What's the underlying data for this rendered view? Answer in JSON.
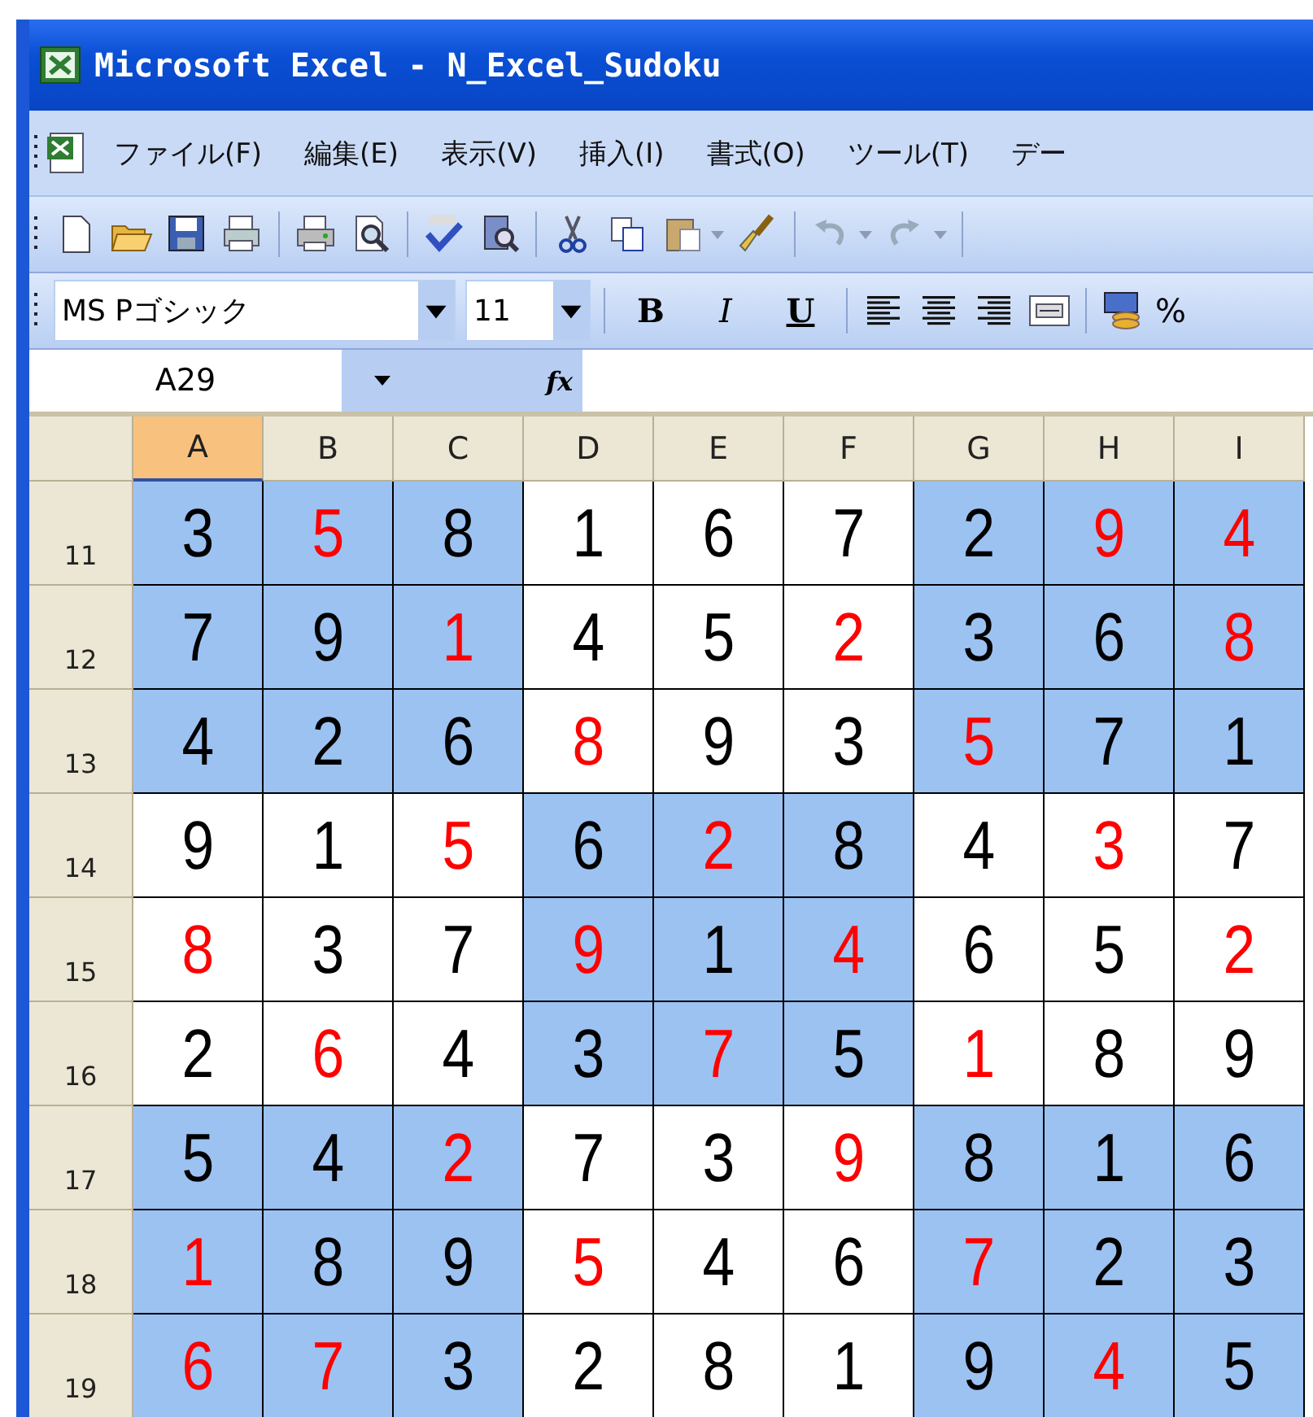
{
  "window": {
    "title": "Microsoft Excel - N_Excel_Sudoku"
  },
  "menu": [
    "ファイル(F)",
    "編集(E)",
    "表示(V)",
    "挿入(I)",
    "書式(O)",
    "ツール(T)",
    "デー"
  ],
  "formatting_toolbar": {
    "font": "MS Pゴシック",
    "size": "11",
    "bold": "B",
    "italic": "I",
    "underline": "U",
    "percent": "%"
  },
  "formula_bar": {
    "name_box": "A29",
    "fx": "fx"
  },
  "sheet": {
    "columns": [
      {
        "label": "A",
        "selected": true
      },
      {
        "label": "B",
        "selected": false
      },
      {
        "label": "C",
        "selected": false
      },
      {
        "label": "D",
        "selected": false
      },
      {
        "label": "E",
        "selected": false
      },
      {
        "label": "F",
        "selected": false
      },
      {
        "label": "G",
        "selected": false
      },
      {
        "label": "H",
        "selected": false
      },
      {
        "label": "I",
        "selected": false
      }
    ],
    "rows": [
      {
        "label": "11",
        "cells": [
          {
            "value": "3",
            "red": false,
            "shaded": true
          },
          {
            "value": "5",
            "red": true,
            "shaded": true
          },
          {
            "value": "8",
            "red": false,
            "shaded": true
          },
          {
            "value": "1",
            "red": false,
            "shaded": false
          },
          {
            "value": "6",
            "red": false,
            "shaded": false
          },
          {
            "value": "7",
            "red": false,
            "shaded": false
          },
          {
            "value": "2",
            "red": false,
            "shaded": true
          },
          {
            "value": "9",
            "red": true,
            "shaded": true
          },
          {
            "value": "4",
            "red": true,
            "shaded": true
          }
        ]
      },
      {
        "label": "12",
        "cells": [
          {
            "value": "7",
            "red": false,
            "shaded": true
          },
          {
            "value": "9",
            "red": false,
            "shaded": true
          },
          {
            "value": "1",
            "red": true,
            "shaded": true
          },
          {
            "value": "4",
            "red": false,
            "shaded": false
          },
          {
            "value": "5",
            "red": false,
            "shaded": false
          },
          {
            "value": "2",
            "red": true,
            "shaded": false
          },
          {
            "value": "3",
            "red": false,
            "shaded": true
          },
          {
            "value": "6",
            "red": false,
            "shaded": true
          },
          {
            "value": "8",
            "red": true,
            "shaded": true
          }
        ]
      },
      {
        "label": "13",
        "cells": [
          {
            "value": "4",
            "red": false,
            "shaded": true
          },
          {
            "value": "2",
            "red": false,
            "shaded": true
          },
          {
            "value": "6",
            "red": false,
            "shaded": true
          },
          {
            "value": "8",
            "red": true,
            "shaded": false
          },
          {
            "value": "9",
            "red": false,
            "shaded": false
          },
          {
            "value": "3",
            "red": false,
            "shaded": false
          },
          {
            "value": "5",
            "red": true,
            "shaded": true
          },
          {
            "value": "7",
            "red": false,
            "shaded": true
          },
          {
            "value": "1",
            "red": false,
            "shaded": true
          }
        ]
      },
      {
        "label": "14",
        "cells": [
          {
            "value": "9",
            "red": false,
            "shaded": false
          },
          {
            "value": "1",
            "red": false,
            "shaded": false
          },
          {
            "value": "5",
            "red": true,
            "shaded": false
          },
          {
            "value": "6",
            "red": false,
            "shaded": true
          },
          {
            "value": "2",
            "red": true,
            "shaded": true
          },
          {
            "value": "8",
            "red": false,
            "shaded": true
          },
          {
            "value": "4",
            "red": false,
            "shaded": false
          },
          {
            "value": "3",
            "red": true,
            "shaded": false
          },
          {
            "value": "7",
            "red": false,
            "shaded": false
          }
        ]
      },
      {
        "label": "15",
        "cells": [
          {
            "value": "8",
            "red": true,
            "shaded": false
          },
          {
            "value": "3",
            "red": false,
            "shaded": false
          },
          {
            "value": "7",
            "red": false,
            "shaded": false
          },
          {
            "value": "9",
            "red": true,
            "shaded": true
          },
          {
            "value": "1",
            "red": false,
            "shaded": true
          },
          {
            "value": "4",
            "red": true,
            "shaded": true
          },
          {
            "value": "6",
            "red": false,
            "shaded": false
          },
          {
            "value": "5",
            "red": false,
            "shaded": false
          },
          {
            "value": "2",
            "red": true,
            "shaded": false
          }
        ]
      },
      {
        "label": "16",
        "cells": [
          {
            "value": "2",
            "red": false,
            "shaded": false
          },
          {
            "value": "6",
            "red": true,
            "shaded": false
          },
          {
            "value": "4",
            "red": false,
            "shaded": false
          },
          {
            "value": "3",
            "red": false,
            "shaded": true
          },
          {
            "value": "7",
            "red": true,
            "shaded": true
          },
          {
            "value": "5",
            "red": false,
            "shaded": true
          },
          {
            "value": "1",
            "red": true,
            "shaded": false
          },
          {
            "value": "8",
            "red": false,
            "shaded": false
          },
          {
            "value": "9",
            "red": false,
            "shaded": false
          }
        ]
      },
      {
        "label": "17",
        "cells": [
          {
            "value": "5",
            "red": false,
            "shaded": true
          },
          {
            "value": "4",
            "red": false,
            "shaded": true
          },
          {
            "value": "2",
            "red": true,
            "shaded": true
          },
          {
            "value": "7",
            "red": false,
            "shaded": false
          },
          {
            "value": "3",
            "red": false,
            "shaded": false
          },
          {
            "value": "9",
            "red": true,
            "shaded": false
          },
          {
            "value": "8",
            "red": false,
            "shaded": true
          },
          {
            "value": "1",
            "red": false,
            "shaded": true
          },
          {
            "value": "6",
            "red": false,
            "shaded": true
          }
        ]
      },
      {
        "label": "18",
        "cells": [
          {
            "value": "1",
            "red": true,
            "shaded": true
          },
          {
            "value": "8",
            "red": false,
            "shaded": true
          },
          {
            "value": "9",
            "red": false,
            "shaded": true
          },
          {
            "value": "5",
            "red": true,
            "shaded": false
          },
          {
            "value": "4",
            "red": false,
            "shaded": false
          },
          {
            "value": "6",
            "red": false,
            "shaded": false
          },
          {
            "value": "7",
            "red": true,
            "shaded": true
          },
          {
            "value": "2",
            "red": false,
            "shaded": true
          },
          {
            "value": "3",
            "red": false,
            "shaded": true
          }
        ]
      },
      {
        "label": "19",
        "cells": [
          {
            "value": "6",
            "red": true,
            "shaded": true
          },
          {
            "value": "7",
            "red": true,
            "shaded": true
          },
          {
            "value": "3",
            "red": false,
            "shaded": true
          },
          {
            "value": "2",
            "red": false,
            "shaded": false
          },
          {
            "value": "8",
            "red": false,
            "shaded": false
          },
          {
            "value": "1",
            "red": false,
            "shaded": false
          },
          {
            "value": "9",
            "red": false,
            "shaded": true
          },
          {
            "value": "4",
            "red": true,
            "shaded": true
          },
          {
            "value": "5",
            "red": false,
            "shaded": true
          }
        ]
      }
    ]
  }
}
